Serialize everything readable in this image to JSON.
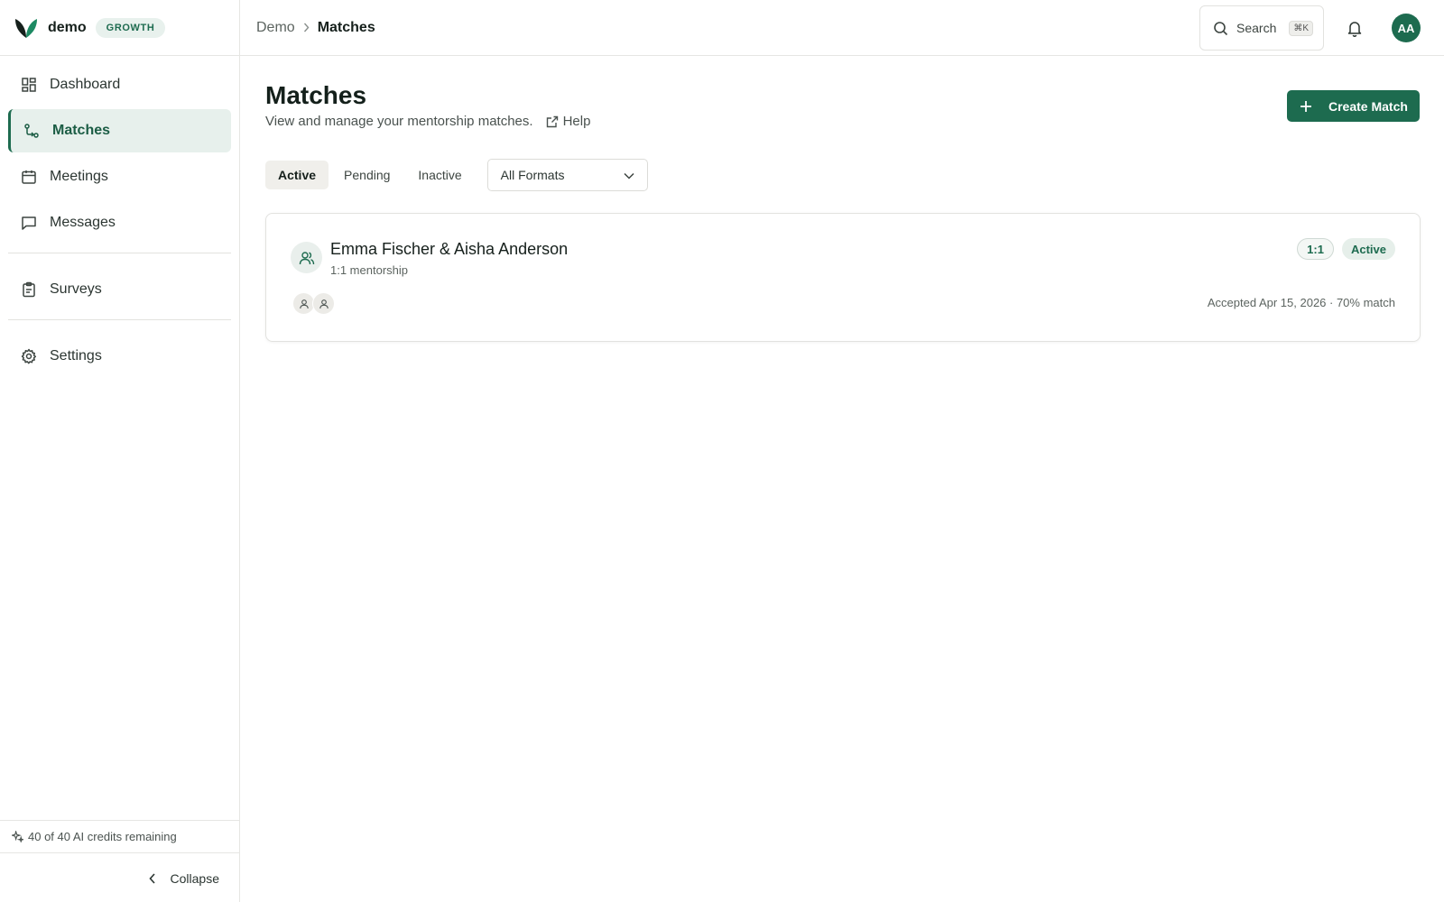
{
  "brand": {
    "name": "demo",
    "plan": "GROWTH"
  },
  "sidebar": {
    "items": [
      {
        "label": "Dashboard"
      },
      {
        "label": "Matches"
      },
      {
        "label": "Meetings"
      },
      {
        "label": "Messages"
      },
      {
        "label": "Surveys"
      },
      {
        "label": "Settings"
      }
    ],
    "active": "Matches",
    "credits": "40 of 40 AI credits remaining",
    "collapse_label": "Collapse"
  },
  "topbar": {
    "breadcrumb": [
      "Demo",
      "Matches"
    ],
    "search_label": "Search",
    "search_shortcut": "⌘K",
    "avatar_initials": "AA"
  },
  "page": {
    "title": "Matches",
    "subtitle": "View and manage your mentorship matches.",
    "help_label": "Help",
    "create_label": "Create Match"
  },
  "filters": {
    "tabs": [
      "Active",
      "Pending",
      "Inactive"
    ],
    "active_tab": "Active",
    "format_select": "All Formats"
  },
  "matches": [
    {
      "title": "Emma Fischer & Aisha Anderson",
      "subtitle": "1:1 mentorship",
      "format_badge": "1:1",
      "status_badge": "Active",
      "meta": "Accepted Apr 15, 2026 · 70% match"
    }
  ],
  "colors": {
    "accent": "#1d6b4f",
    "accent_light": "#e7f0ec"
  }
}
